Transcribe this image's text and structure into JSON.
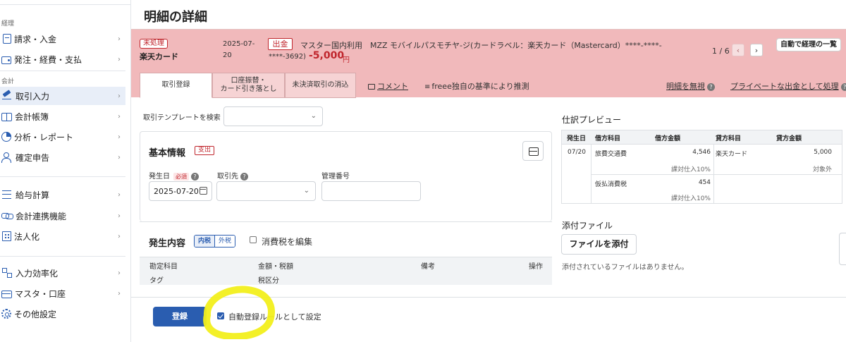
{
  "sidebar": {
    "section_keiri": "経理",
    "section_kaikei": "会計",
    "items": [
      {
        "label": "請求・入金",
        "icon": "document-icon"
      },
      {
        "label": "発注・経費・支払",
        "icon": "wallet-icon"
      },
      {
        "label": "取引入力",
        "icon": "pen-icon",
        "active": true
      },
      {
        "label": "会計帳簿",
        "icon": "book-icon"
      },
      {
        "label": "分析・レポート",
        "icon": "pie-chart-icon"
      },
      {
        "label": "確定申告",
        "icon": "person-icon"
      },
      {
        "label": "給与計算",
        "icon": "list-icon"
      },
      {
        "label": "会計連携機能",
        "icon": "link-icon"
      },
      {
        "label": "法人化",
        "icon": "building-icon"
      },
      {
        "label": "入力効率化",
        "icon": "flow-icon"
      },
      {
        "label": "マスタ・口座",
        "icon": "card-icon"
      },
      {
        "label": "その他設定",
        "icon": "gear-icon"
      }
    ],
    "chevron": "›"
  },
  "page": {
    "title": "明細の詳細"
  },
  "transaction": {
    "status_badge": "未処理",
    "account": "楽天カード",
    "date_line1": "2025-07-",
    "date_line2": "20",
    "direction_badge": "出金",
    "description_line1": "マスター国内利用　MZZ モバイルパスモチヤ-ジ(カードラベル：楽天カード（Mastercard）****-****-",
    "description_line2": "****-3692)",
    "amount": "-5,000",
    "currency": "円",
    "pager": "1 / 6",
    "prev": "‹",
    "next": "›",
    "auto_list_button": "自動で経理の一覧"
  },
  "tabs": [
    {
      "label": "取引登録",
      "active": true
    },
    {
      "label_line1": "口座振替・",
      "label_line2": "カード引き落とし"
    },
    {
      "label": "未決済取引の消込"
    }
  ],
  "tab_links": {
    "comment": "コメント",
    "estimate": "freee独自の基準により推測",
    "ignore": "明細を無視",
    "private": "プライベートな出金として処理"
  },
  "form": {
    "template_search_label": "取引テンプレートを検索",
    "basic_info_title": "基本情報",
    "expense_badge": "支出",
    "date_label": "発生日",
    "required_badge": "必須",
    "partner_label": "取引先",
    "mgmt_no_label": "管理番号",
    "date_value": "2025-07-20",
    "occurrence_title": "発生内容",
    "tax_incl": "内税",
    "tax_excl": "外税",
    "edit_tax_label": "消費税を編集",
    "col_account": "勘定科目",
    "col_amount_tax": "金額・税額",
    "col_note": "備考",
    "col_action": "操作",
    "col_tag": "タグ",
    "col_tax_class": "税区分",
    "help": "?"
  },
  "preview": {
    "title": "仕訳プレビュー",
    "headers": [
      "発生日",
      "借方科目",
      "借方金額",
      "貸方科目",
      "貸方金額"
    ],
    "rows": [
      {
        "date": "07/20",
        "debit_account": "旅費交通費",
        "debit_amount": "4,546",
        "debit_tax": "課対仕入10%",
        "credit_account": "楽天カード",
        "credit_amount": "5,000",
        "credit_tax": "対象外"
      },
      {
        "date": "",
        "debit_account": "仮払消費税",
        "debit_amount": "454",
        "debit_tax": "課対仕入10%",
        "credit_account": "",
        "credit_amount": "",
        "credit_tax": ""
      }
    ]
  },
  "attachments": {
    "title": "添付ファイル",
    "button": "ファイルを添付",
    "empty_text": "添付されているファイルはありません。"
  },
  "footer": {
    "register_button": "登録",
    "auto_rule_label": "自動登録ルールとして設定",
    "auto_rule_checked": true
  },
  "colors": {
    "banner": "#f1b9bb",
    "accent_blue": "#2a5db0",
    "alert_red": "#c0262d",
    "highlight_yellow": "#f2ef1c"
  }
}
